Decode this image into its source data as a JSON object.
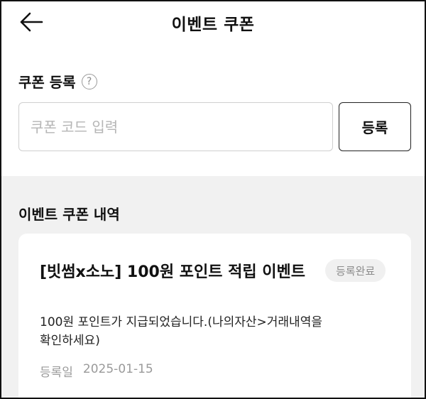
{
  "header": {
    "title": "이벤트 쿠폰",
    "back_icon": "arrow-left-icon"
  },
  "register": {
    "label": "쿠폰 등록",
    "help_icon": "question-circle-icon",
    "help_glyph": "?",
    "input_placeholder": "쿠폰 코드 입력",
    "input_value": "",
    "button_label": "등록"
  },
  "history": {
    "title": "이벤트 쿠폰 내역",
    "items": [
      {
        "name": "[빗썸x소노] 100원 포인트 적립 이벤트",
        "status": "등록완료",
        "description": "100원 포인트가 지급되었습니다.(나의자산>거래내역을 확인하세요)",
        "date_label": "등록일",
        "date": "2025-01-15"
      }
    ]
  },
  "colors": {
    "background": "#ffffff",
    "section_background": "#f1f1f1",
    "badge_background": "#f0f0f0",
    "muted_text": "#9a9a9a",
    "border": "#cfcfcf"
  }
}
